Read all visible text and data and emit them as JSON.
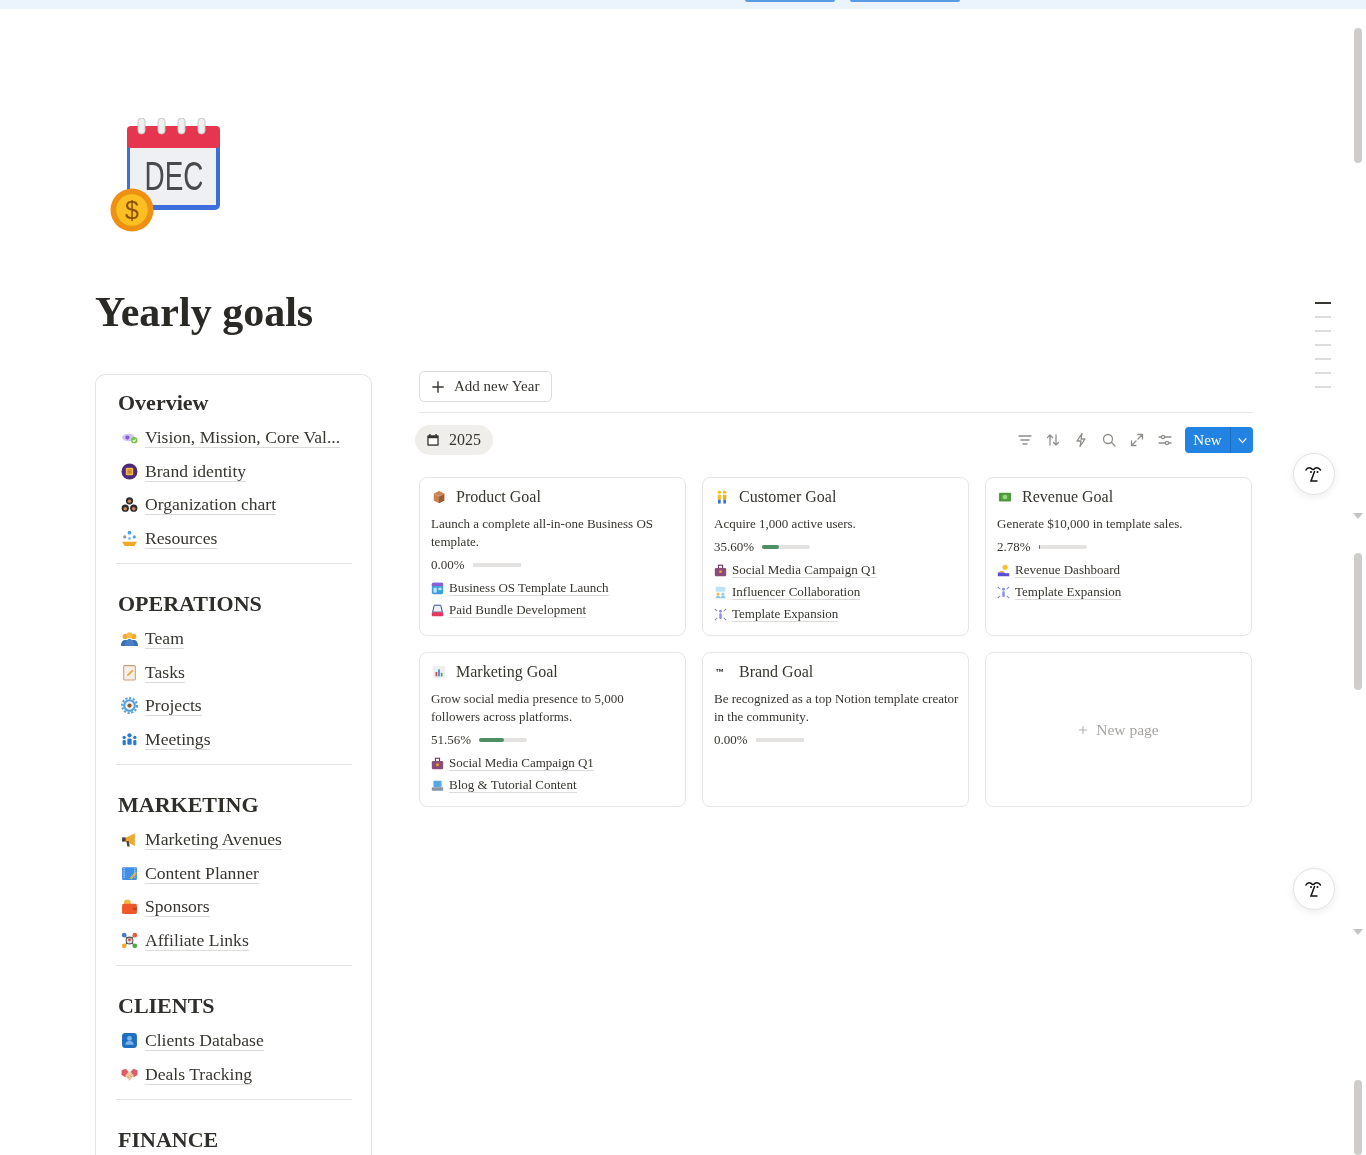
{
  "page": {
    "icon": {
      "month": "DEC",
      "symbol": "$"
    },
    "title": "Yearly goals"
  },
  "sidebar": {
    "sections": [
      {
        "heading": "Overview",
        "items": [
          {
            "label": "Vision, Mission, Core Val..."
          },
          {
            "label": "Brand identity"
          },
          {
            "label": "Organization chart"
          },
          {
            "label": "Resources"
          }
        ]
      },
      {
        "heading": "OPERATIONS",
        "items": [
          {
            "label": "Team"
          },
          {
            "label": "Tasks"
          },
          {
            "label": "Projects"
          },
          {
            "label": "Meetings"
          }
        ]
      },
      {
        "heading": "MARKETING",
        "items": [
          {
            "label": "Marketing Avenues"
          },
          {
            "label": "Content Planner"
          },
          {
            "label": "Sponsors"
          },
          {
            "label": "Affiliate Links"
          }
        ]
      },
      {
        "heading": "CLIENTS",
        "items": [
          {
            "label": "Clients Database"
          },
          {
            "label": "Deals Tracking"
          }
        ]
      },
      {
        "heading": "FINANCE"
      }
    ]
  },
  "board": {
    "add_button": {
      "label": "Add new Year"
    },
    "views": [
      {
        "label": "2025",
        "selected": true
      }
    ],
    "new_button": {
      "label": "New"
    },
    "goals": [
      {
        "title": "Product Goal",
        "description": "Launch a complete all-in-one Business OS template.",
        "progress": "0.00%",
        "level": 0,
        "links": [
          {
            "label": "Business OS Template Launch"
          },
          {
            "label": "Paid Bundle Development"
          }
        ]
      },
      {
        "title": "Customer Goal",
        "description": "Acquire 1,000 active users.",
        "progress": "35.60%",
        "level": 0.356,
        "links": [
          {
            "label": "Social Media Campaign Q1"
          },
          {
            "label": "Influencer Collaboration"
          },
          {
            "label": "Template Expansion"
          }
        ]
      },
      {
        "title": "Revenue Goal",
        "description": "Generate $10,000 in template sales.",
        "progress": "2.78%",
        "level": 0.0278,
        "links": [
          {
            "label": "Revenue Dashboard"
          },
          {
            "label": "Template Expansion"
          }
        ]
      },
      {
        "title": "Marketing Goal",
        "description": "Grow social media presence to 5,000 followers across platforms.",
        "progress": "51.56%",
        "level": 0.5156,
        "links": [
          {
            "label": "Social Media Campaign Q1"
          },
          {
            "label": "Blog & Tutorial Content"
          }
        ]
      },
      {
        "title": "Brand Goal",
        "symbol": "™",
        "description": "Be recognized as a top Notion template creator in the community.",
        "progress": "0.00%",
        "level": 0
      }
    ],
    "new_card": {
      "label": "New page"
    }
  },
  "outline": [
    {
      "selected": true
    },
    {
      "selected": false
    },
    {
      "selected": false
    },
    {
      "selected": false
    },
    {
      "selected": false
    },
    {
      "selected": false
    },
    {
      "selected": false
    }
  ]
}
